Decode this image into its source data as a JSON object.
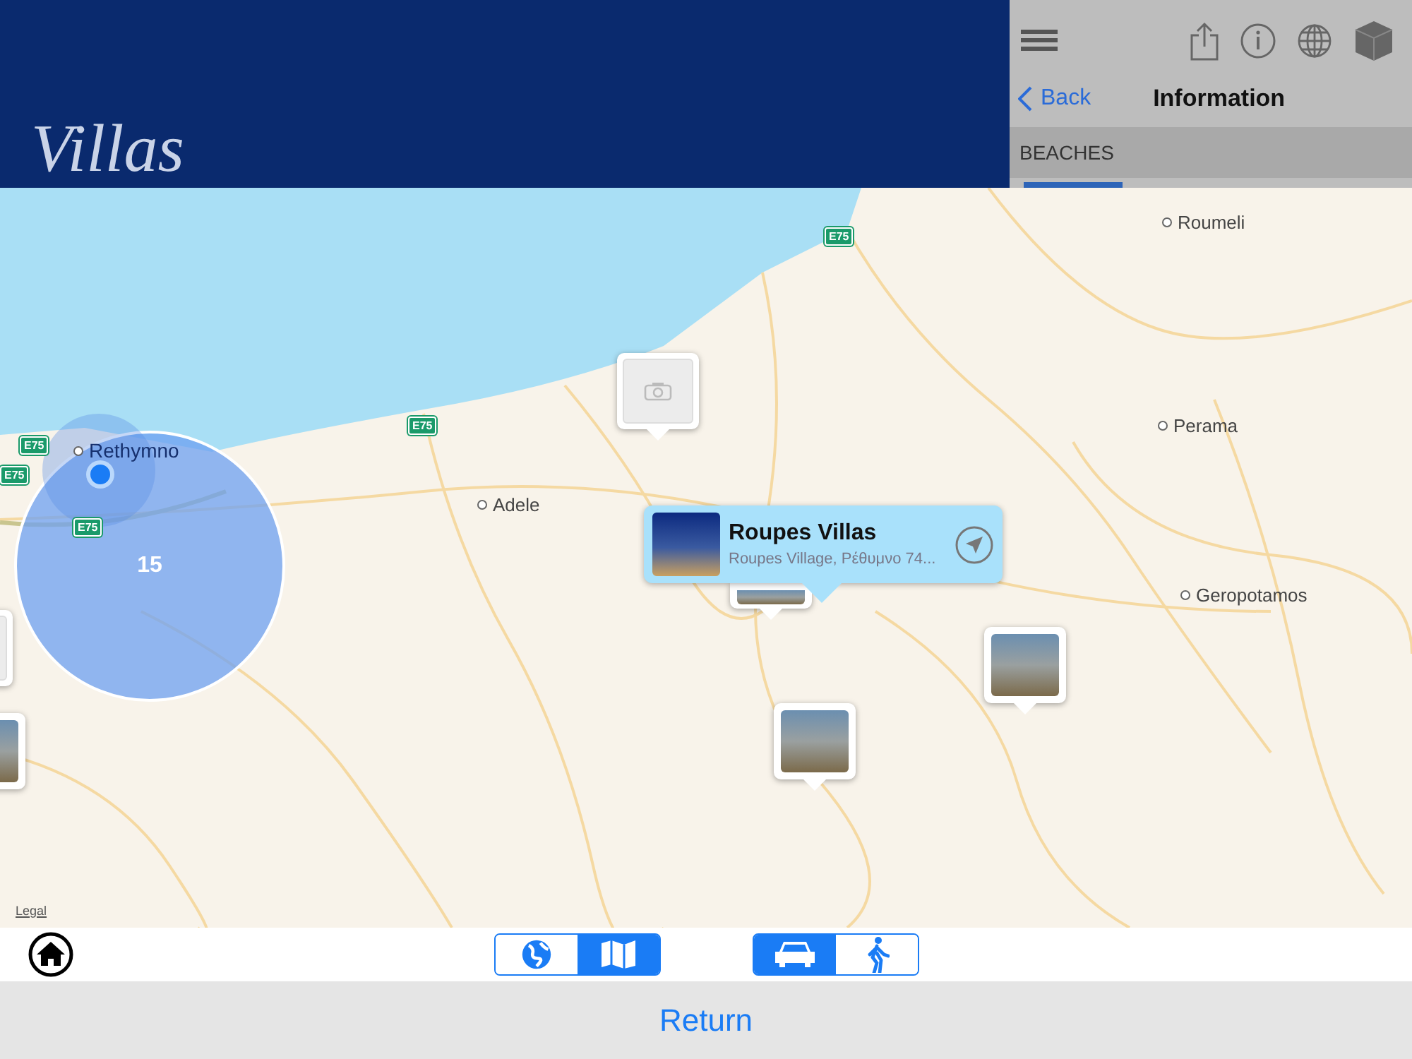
{
  "header": {
    "title": "Villas"
  },
  "side_panel": {
    "back": "Back",
    "title": "Information",
    "section": "BEACHES"
  },
  "map": {
    "places": [
      {
        "name": "Roumeli"
      },
      {
        "name": "Perama"
      },
      {
        "name": "Adele"
      },
      {
        "name": "Geropotamos"
      },
      {
        "name": "Rethymno"
      }
    ],
    "road_shields": [
      "E75",
      "E75",
      "E75",
      "E75",
      "E75"
    ],
    "cluster": {
      "count": "15"
    },
    "callout": {
      "title": "Roupes Villas",
      "subtitle": "Roupes Village, Ρέθυμνο 74..."
    },
    "legal": "Legal"
  },
  "toolbar": {
    "map_type": [
      {
        "kind": "satellite",
        "selected": false
      },
      {
        "kind": "map",
        "selected": true
      }
    ],
    "transport": [
      {
        "kind": "car",
        "selected": true
      },
      {
        "kind": "walk",
        "selected": false
      }
    ]
  },
  "footer": {
    "button": "Return"
  }
}
